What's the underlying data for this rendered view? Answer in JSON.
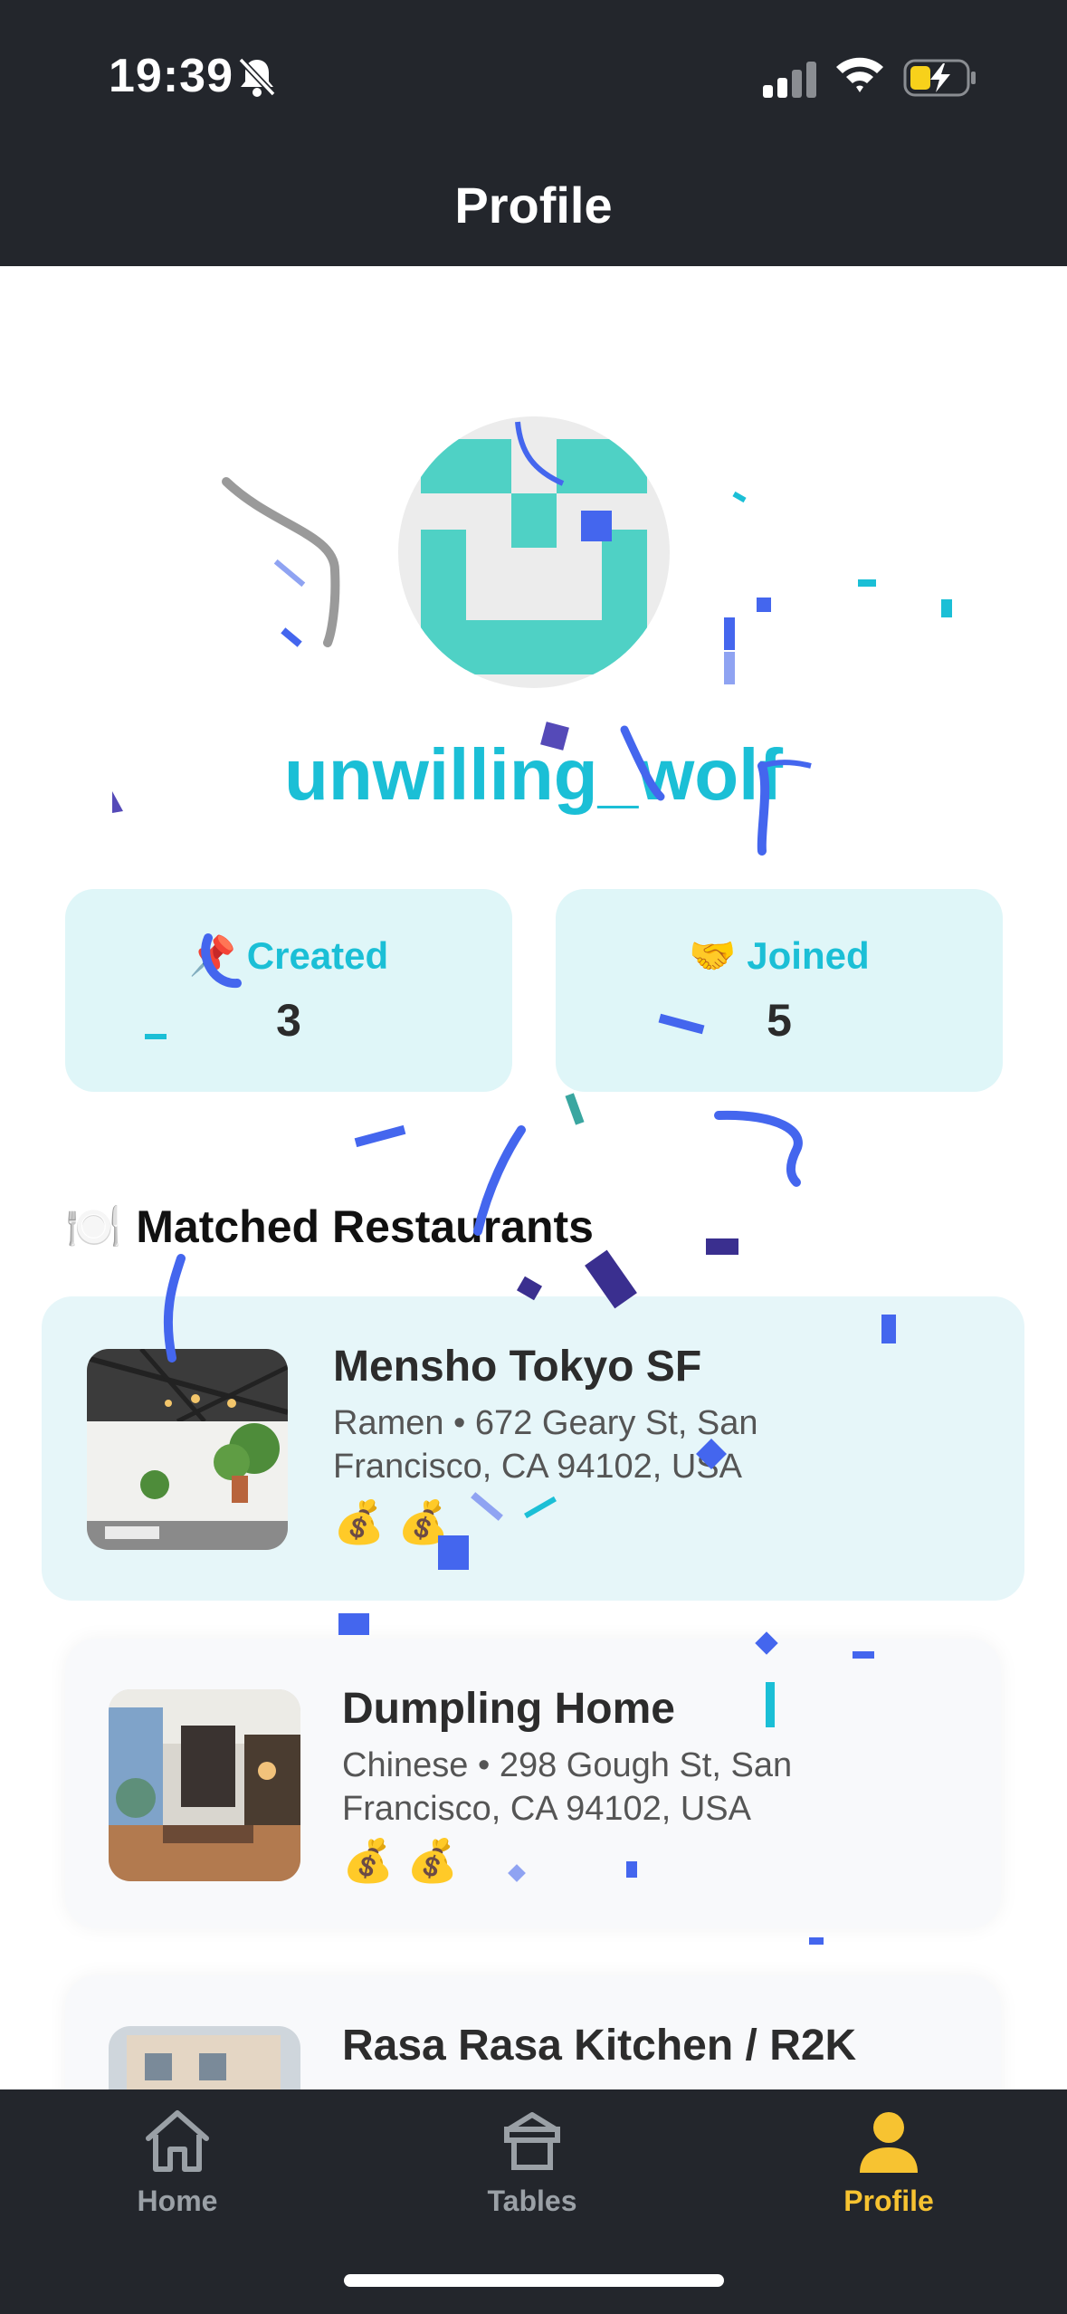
{
  "status_bar": {
    "time": "19:39",
    "icons": [
      "bell-slash-icon",
      "cellular-signal-icon",
      "wifi-icon",
      "battery-charging-icon"
    ]
  },
  "header": {
    "title": "Profile"
  },
  "profile": {
    "username": "unwilling_wolf",
    "accent_color": "#1bbfd6",
    "avatar_color": "#4fd1c5"
  },
  "stats": {
    "created": {
      "emoji": "📌",
      "label": "Created",
      "value": "3"
    },
    "joined": {
      "emoji": "🤝",
      "label": "Joined",
      "value": "5"
    }
  },
  "matched": {
    "emoji": "🍽️",
    "title": "Matched Restaurants",
    "restaurants": [
      {
        "name": "Mensho Tokyo SF",
        "cuisine": "Ramen",
        "address": "672 Geary St, San Francisco, CA 94102, USA",
        "price": "💰💰"
      },
      {
        "name": "Dumpling Home",
        "cuisine": "Chinese",
        "address": "298 Gough St, San Francisco, CA 94102, USA",
        "price": "💰💰"
      },
      {
        "name": "Rasa Rasa Kitchen / R2K",
        "cuisine": "",
        "address": "",
        "price": ""
      }
    ]
  },
  "tab_bar": {
    "tabs": [
      {
        "label": "Home",
        "icon": "home-icon"
      },
      {
        "label": "Tables",
        "icon": "tables-icon"
      },
      {
        "label": "Profile",
        "icon": "person-icon"
      }
    ],
    "active_color": "#f7c331"
  }
}
